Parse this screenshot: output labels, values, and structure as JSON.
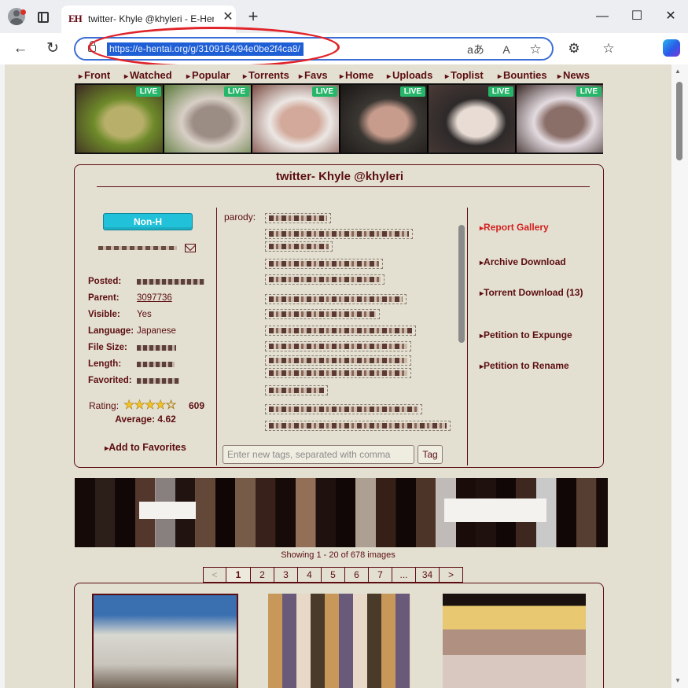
{
  "browser": {
    "tab_title": "twitter- Khyle @khyleri - E-Hentai",
    "tab_favicon": "EH",
    "url_text": "https://e-hentai.org/g/3109164/94e0be2f4ca8/",
    "icons": {
      "profile": "profile-icon",
      "tabs": "tab-actions-icon",
      "close": "close-icon",
      "new_tab": "plus-icon",
      "minimize": "minimize-icon",
      "maximize": "maximize-icon",
      "window_close": "window-close-icon",
      "back": "back-arrow-icon",
      "refresh": "refresh-icon",
      "lock": "lock-icon",
      "read_mode": "read-mode-icon",
      "read_aloud": "read-aloud-icon",
      "favorite": "star-icon",
      "extensions": "extensions-icon",
      "favorites": "favorites-icon",
      "copilot": "copilot-icon"
    },
    "glyphs": {
      "close": "✕",
      "new_tab": "+",
      "minimize": "—",
      "maximize": "☐",
      "window_close": "✕",
      "back": "←",
      "refresh": "↻",
      "read_mode": "aあ",
      "read_aloud": "A",
      "favorite": "☆",
      "extensions": "⚙",
      "favorites": "☆"
    },
    "annotation_color": "#e0242b",
    "address_border_color": "#3b6fd6"
  },
  "site_nav": [
    "Front",
    "Watched",
    "Popular",
    "Torrents",
    "Favs",
    "Home",
    "Uploads",
    "Toplist",
    "Bounties",
    "News"
  ],
  "banner": {
    "badge": "LIVE",
    "next_label": "»",
    "thumbs": [
      {
        "c1": "#6e8a2a",
        "c2": "#b8b06a",
        "c3": "#3c2a22"
      },
      {
        "c1": "#d8cfc6",
        "c2": "#9b8c84",
        "c3": "#5a7a3a"
      },
      {
        "c1": "#ece7e4",
        "c2": "#d2a99a",
        "c3": "#7a4a40"
      },
      {
        "c1": "#3a3632",
        "c2": "#c79c8c",
        "c3": "#1a1614"
      },
      {
        "c1": "#2e2a2a",
        "c2": "#e8dcd4",
        "c3": "#4a3a36"
      },
      {
        "c1": "#e3dbe0",
        "c2": "#8a6e68",
        "c3": "#3a2826"
      }
    ]
  },
  "gallery": {
    "title": "twitter- Khyle @khyleri",
    "category": "Non-H",
    "category_color": "#21c1d9",
    "meta": [
      {
        "label": "Posted:",
        "value": "",
        "blur": 86
      },
      {
        "label": "Parent:",
        "value": "3097736",
        "blur": 0,
        "link": true
      },
      {
        "label": "Visible:",
        "value": "Yes",
        "blur": 0
      },
      {
        "label": "Language:",
        "value": "Japanese",
        "blur": 0
      },
      {
        "label": "File Size:",
        "value": "",
        "blur": 50
      },
      {
        "label": "Length:",
        "value": "",
        "blur": 48
      },
      {
        "label": "Favorited:",
        "value": "",
        "blur": 54
      }
    ],
    "rating_label": "Rating:",
    "rating_value": 4.62,
    "rating_count": "609",
    "average_label": "Average: 4.62",
    "add_favorites": "Add to Favorites",
    "tag_namespace": "parody:",
    "tag_rows": [
      {
        "w": 84
      },
      {
        "w": 188
      },
      {
        "w": 86
      },
      {
        "w": 150
      },
      {
        "w": 152
      },
      {
        "w": 180
      },
      {
        "w": 146
      },
      {
        "w": 192
      },
      {
        "w": 186
      },
      {
        "w": 186
      },
      {
        "w": 186
      },
      {
        "w": 80
      },
      {
        "w": 200
      },
      {
        "w": 236
      }
    ],
    "tag_input_placeholder": "Enter new tags, separated with comma",
    "tag_button": "Tag",
    "actions": [
      {
        "label": "Report Gallery",
        "red": true
      },
      {
        "label": "Archive Download",
        "red": false
      },
      {
        "label": "Torrent Download (13)",
        "red": false
      },
      {
        "label": "Petition to Expunge",
        "red": false
      },
      {
        "label": "Petition to Rename",
        "red": false
      }
    ]
  },
  "results": {
    "showing": "Showing 1 - 20 of 678 images",
    "pages": [
      "<",
      "1",
      "2",
      "3",
      "4",
      "5",
      "6",
      "7",
      "...",
      "34",
      ">"
    ],
    "current_page": "1"
  }
}
